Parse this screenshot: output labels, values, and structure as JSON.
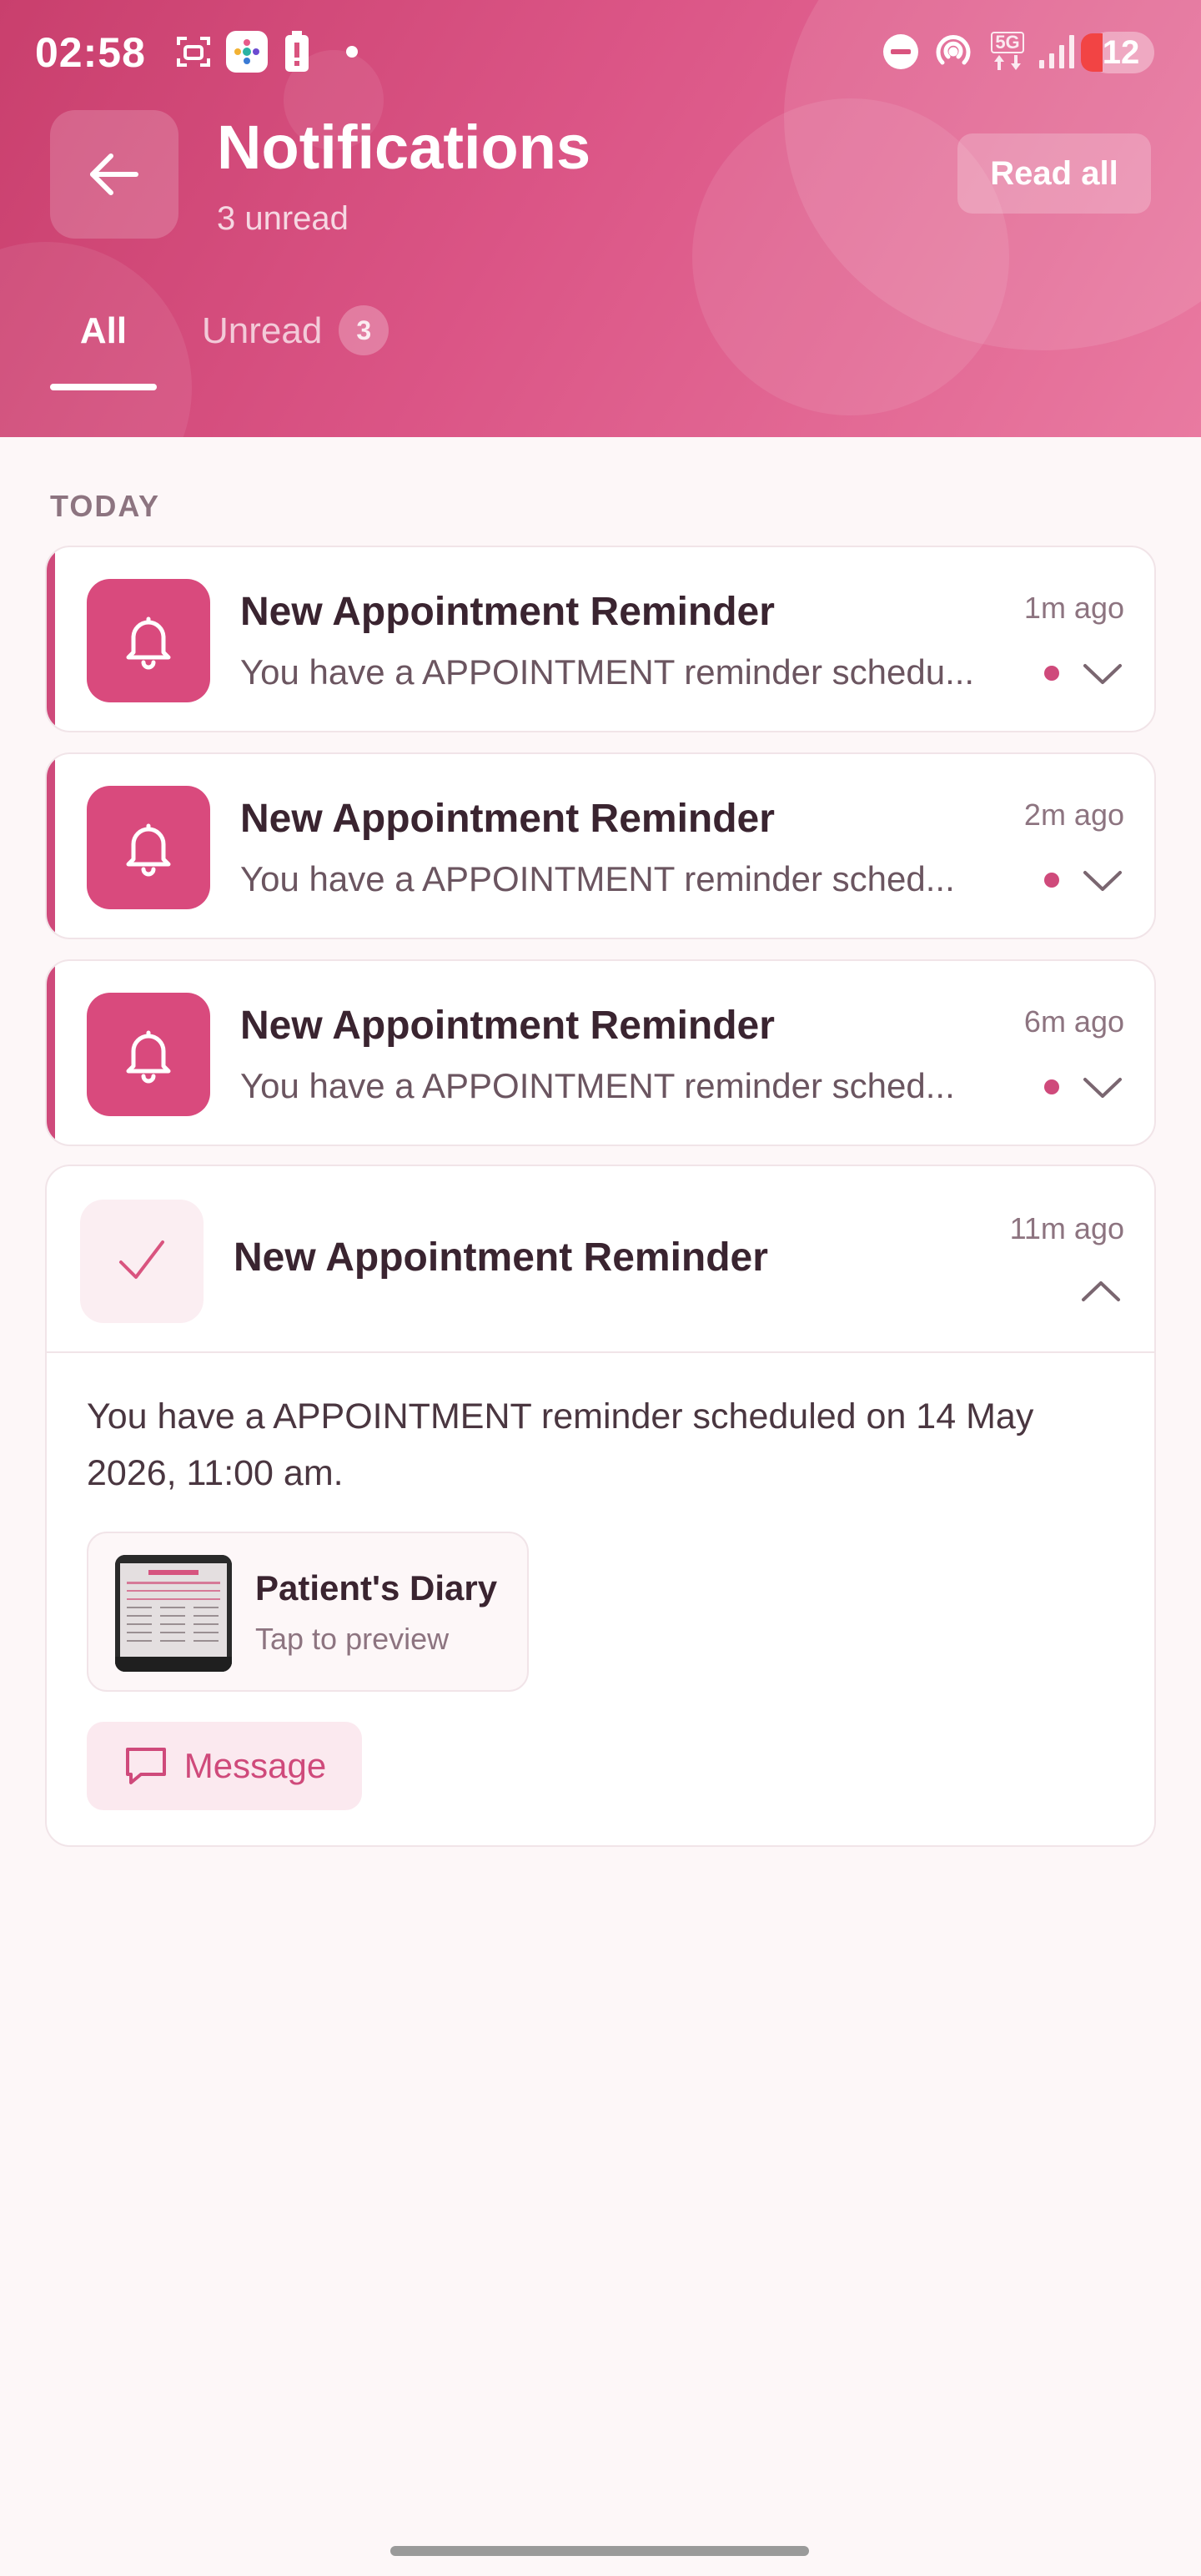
{
  "status_bar": {
    "time": "02:58",
    "network": "5G",
    "battery": "12"
  },
  "header": {
    "title": "Notifications",
    "subtitle": "3 unread",
    "read_all_label": "Read all"
  },
  "tabs": {
    "all_label": "All",
    "unread_label": "Unread",
    "unread_count": "3"
  },
  "section": {
    "label": "TODAY"
  },
  "notifications": [
    {
      "title": "New Appointment Reminder",
      "preview": "You have a APPOINTMENT reminder schedu...",
      "time": "1m ago",
      "unread": true
    },
    {
      "title": "New Appointment Reminder",
      "preview": "You have a APPOINTMENT reminder sched...",
      "time": "2m ago",
      "unread": true
    },
    {
      "title": "New Appointment Reminder",
      "preview": "You have a APPOINTMENT reminder sched...",
      "time": "6m ago",
      "unread": true
    }
  ],
  "expanded": {
    "title": "New Appointment Reminder",
    "time": "11m ago",
    "body": "You have a APPOINTMENT reminder scheduled on 14 May 2026, 11:00 am.",
    "attachment": {
      "name": "Patient's Diary",
      "hint": "Tap to preview"
    },
    "message_label": "Message"
  },
  "colors": {
    "accent": "#cf4a7b",
    "header_start": "#c93f6d",
    "header_end": "#e97aa1"
  }
}
